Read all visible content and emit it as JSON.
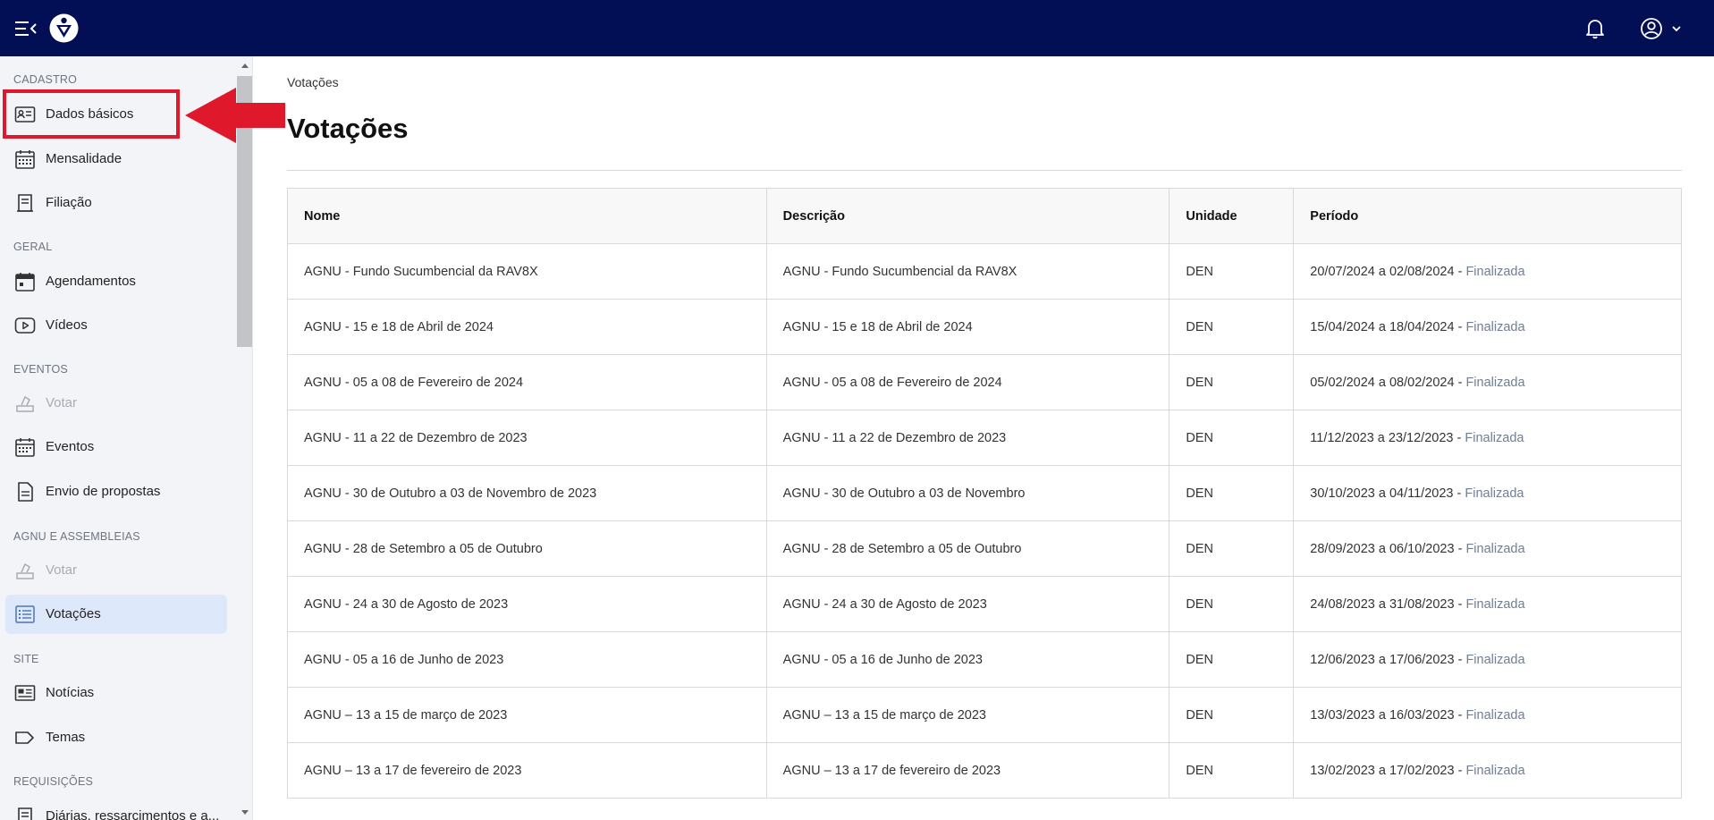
{
  "header": {
    "notifications_icon": "bell-icon",
    "user_icon": "user-circle-icon"
  },
  "sidebar": {
    "sections": [
      {
        "title": "CADASTRO"
      },
      {
        "title": "GERAL"
      },
      {
        "title": "EVENTOS"
      },
      {
        "title": "AGNU E ASSEMBLEIAS"
      },
      {
        "title": "SITE"
      },
      {
        "title": "REQUISIÇÕES"
      }
    ],
    "items": [
      {
        "label": "Dados básicos",
        "icon": "id-card-icon"
      },
      {
        "label": "Mensalidade",
        "icon": "calendar-grid-icon"
      },
      {
        "label": "Filiação",
        "icon": "document-icon"
      },
      {
        "label": "Agendamentos",
        "icon": "calendar-icon"
      },
      {
        "label": "Vídeos",
        "icon": "play-icon"
      },
      {
        "label": "Votar",
        "icon": "vote-icon",
        "disabled": true
      },
      {
        "label": "Eventos",
        "icon": "calendar-grid-icon"
      },
      {
        "label": "Envio de propostas",
        "icon": "file-icon"
      },
      {
        "label": "Votar",
        "icon": "vote-icon",
        "disabled": true
      },
      {
        "label": "Votações",
        "icon": "list-icon",
        "active": true
      },
      {
        "label": "Notícias",
        "icon": "news-icon"
      },
      {
        "label": "Temas",
        "icon": "tag-icon"
      },
      {
        "label": "Diárias, ressarcimentos e a...",
        "icon": "receipt-icon"
      }
    ]
  },
  "main": {
    "breadcrumb": "Votações",
    "title": "Votações",
    "table": {
      "headers": [
        "Nome",
        "Descrição",
        "Unidade",
        "Período"
      ],
      "rows": [
        {
          "nome": "AGNU - Fundo Sucumbencial da RAV8X",
          "descricao": "AGNU - Fundo Sucumbencial da RAV8X",
          "unidade": "DEN",
          "periodo": "20/07/2024 a 02/08/2024 - ",
          "status": "Finalizada"
        },
        {
          "nome": "AGNU - 15 e 18 de Abril de 2024",
          "descricao": "AGNU - 15 e 18 de Abril de 2024",
          "unidade": "DEN",
          "periodo": "15/04/2024 a 18/04/2024 - ",
          "status": "Finalizada"
        },
        {
          "nome": "AGNU - 05 a 08 de Fevereiro de 2024",
          "descricao": "AGNU - 05 a 08 de Fevereiro de 2024",
          "unidade": "DEN",
          "periodo": "05/02/2024 a 08/02/2024 - ",
          "status": "Finalizada"
        },
        {
          "nome": "AGNU - 11 a 22 de Dezembro de 2023",
          "descricao": "AGNU - 11 a 22 de Dezembro de 2023",
          "unidade": "DEN",
          "periodo": "11/12/2023 a 23/12/2023 - ",
          "status": "Finalizada"
        },
        {
          "nome": "AGNU - 30 de Outubro a 03 de Novembro de 2023",
          "descricao": "AGNU - 30 de Outubro a 03 de Novembro",
          "unidade": "DEN",
          "periodo": "30/10/2023 a 04/11/2023 - ",
          "status": "Finalizada"
        },
        {
          "nome": "AGNU - 28 de Setembro a 05 de Outubro",
          "descricao": "AGNU - 28 de Setembro a 05 de Outubro",
          "unidade": "DEN",
          "periodo": "28/09/2023 a 06/10/2023 - ",
          "status": "Finalizada"
        },
        {
          "nome": "AGNU - 24 a 30 de Agosto de 2023",
          "descricao": "AGNU - 24 a 30 de Agosto de 2023",
          "unidade": "DEN",
          "periodo": "24/08/2023 a 31/08/2023 - ",
          "status": "Finalizada"
        },
        {
          "nome": "AGNU - 05 a 16 de Junho de 2023",
          "descricao": "AGNU - 05 a 16 de Junho de 2023",
          "unidade": "DEN",
          "periodo": "12/06/2023 a 17/06/2023 - ",
          "status": "Finalizada"
        },
        {
          "nome": "AGNU – 13 a 15 de março de 2023",
          "descricao": "AGNU – 13 a 15 de março de 2023",
          "unidade": "DEN",
          "periodo": "13/03/2023 a 16/03/2023 - ",
          "status": "Finalizada"
        },
        {
          "nome": "AGNU – 13 a 17 de fevereiro de 2023",
          "descricao": "AGNU – 13 a 17 de fevereiro de 2023",
          "unidade": "DEN",
          "periodo": "13/02/2023 a 17/02/2023 - ",
          "status": "Finalizada"
        }
      ]
    }
  },
  "colors": {
    "topbar": "#020f55",
    "active_item": "#dde9fb",
    "annotation": "#e0182b",
    "status": "#6f7f96"
  }
}
